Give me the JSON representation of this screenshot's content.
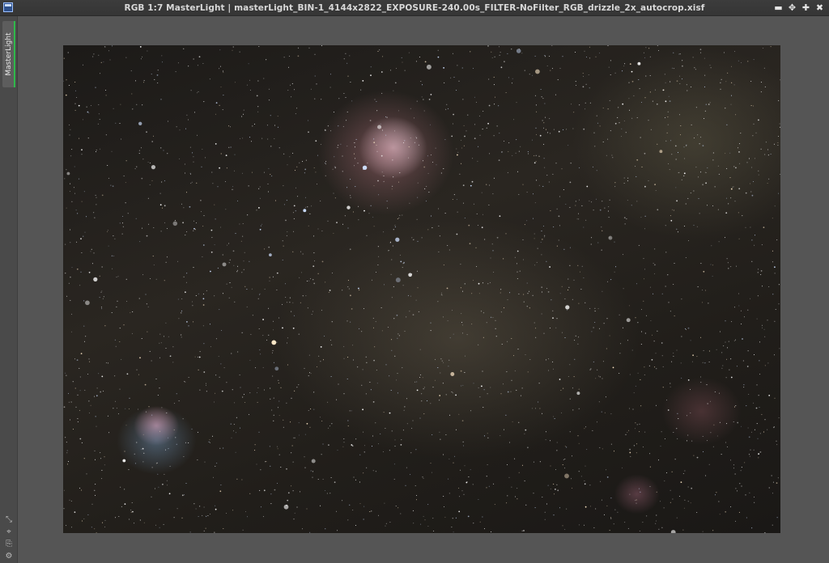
{
  "window": {
    "title": "RGB 1:7 MasterLight | masterLight_BIN-1_4144x2822_EXPOSURE-240.00s_FILTER-NoFilter_RGB_drizzle_2x_autocrop.xisf",
    "controls": {
      "minimize": "▬",
      "shade": "✥",
      "maximize": "✚",
      "close": "✖"
    },
    "icon": "image-window-icon"
  },
  "side_panel": {
    "tab_label": "MasterLight",
    "accent_color": "#2fb84a",
    "icons": [
      "fit-view-icon",
      "zoom-icon",
      "lock-icon",
      "settings-icon"
    ]
  },
  "image": {
    "description_icon": "astrophoto-image",
    "colors": {
      "background": "#1f1c19",
      "nebula_pink": "#b47a84",
      "nebula_blue": "#7ea6c8"
    }
  }
}
